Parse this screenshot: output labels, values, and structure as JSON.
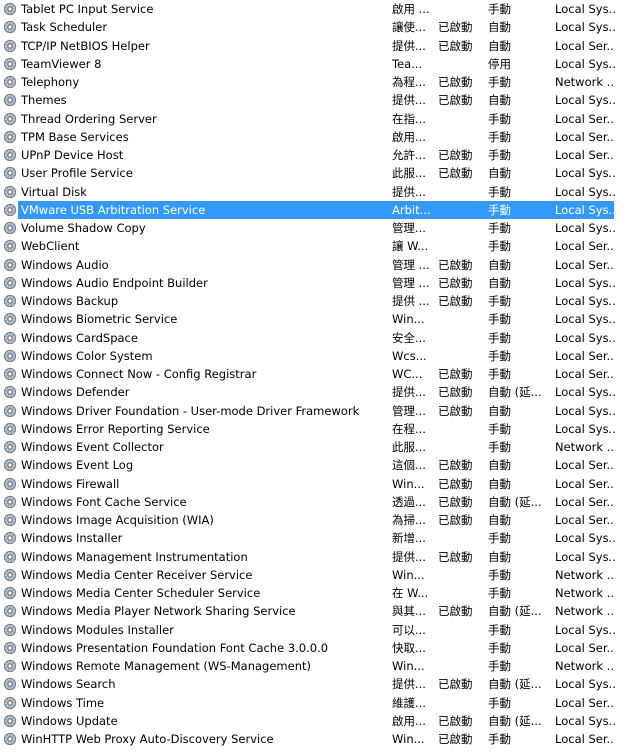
{
  "services": [
    {
      "name": "Tablet PC Input Service",
      "desc": "啟用 ...",
      "status": "",
      "startup": "手動",
      "logon": "Local Sys..."
    },
    {
      "name": "Task Scheduler",
      "desc": "讓使...",
      "status": "已啟動",
      "startup": "自動",
      "logon": "Local Sys..."
    },
    {
      "name": "TCP/IP NetBIOS Helper",
      "desc": "提供...",
      "status": "已啟動",
      "startup": "自動",
      "logon": "Local Ser..."
    },
    {
      "name": "TeamViewer 8",
      "desc": "Tea...",
      "status": "",
      "startup": "停用",
      "logon": "Local Sys..."
    },
    {
      "name": "Telephony",
      "desc": "為程...",
      "status": "已啟動",
      "startup": "手動",
      "logon": "Network ..."
    },
    {
      "name": "Themes",
      "desc": "提供...",
      "status": "已啟動",
      "startup": "自動",
      "logon": "Local Sys..."
    },
    {
      "name": "Thread Ordering Server",
      "desc": "在指...",
      "status": "",
      "startup": "手動",
      "logon": "Local Ser..."
    },
    {
      "name": "TPM Base Services",
      "desc": "啟用...",
      "status": "",
      "startup": "手動",
      "logon": "Local Ser..."
    },
    {
      "name": "UPnP Device Host",
      "desc": "允許...",
      "status": "已啟動",
      "startup": "手動",
      "logon": "Local Ser..."
    },
    {
      "name": "User Profile Service",
      "desc": "此服...",
      "status": "已啟動",
      "startup": "自動",
      "logon": "Local Sys..."
    },
    {
      "name": "Virtual Disk",
      "desc": "提供...",
      "status": "",
      "startup": "手動",
      "logon": "Local Sys..."
    },
    {
      "name": "VMware USB Arbitration Service",
      "desc": "Arbit...",
      "status": "",
      "startup": "手動",
      "logon": "Local Sys...",
      "selected": true
    },
    {
      "name": "Volume Shadow Copy",
      "desc": "管理...",
      "status": "",
      "startup": "手動",
      "logon": "Local Sys..."
    },
    {
      "name": "WebClient",
      "desc": "讓 W...",
      "status": "",
      "startup": "手動",
      "logon": "Local Ser..."
    },
    {
      "name": "Windows Audio",
      "desc": "管理 ...",
      "status": "已啟動",
      "startup": "自動",
      "logon": "Local Ser..."
    },
    {
      "name": "Windows Audio Endpoint Builder",
      "desc": "管理 ...",
      "status": "已啟動",
      "startup": "自動",
      "logon": "Local Sys..."
    },
    {
      "name": "Windows Backup",
      "desc": "提供 ...",
      "status": "已啟動",
      "startup": "手動",
      "logon": "Local Sys..."
    },
    {
      "name": "Windows Biometric Service",
      "desc": "Win...",
      "status": "",
      "startup": "手動",
      "logon": "Local Sys..."
    },
    {
      "name": "Windows CardSpace",
      "desc": "安全...",
      "status": "",
      "startup": "手動",
      "logon": "Local Sys..."
    },
    {
      "name": "Windows Color System",
      "desc": "Wcs...",
      "status": "",
      "startup": "手動",
      "logon": "Local Ser..."
    },
    {
      "name": "Windows Connect Now - Config Registrar",
      "desc": "WC...",
      "status": "已啟動",
      "startup": "手動",
      "logon": "Local Ser..."
    },
    {
      "name": "Windows Defender",
      "desc": "提供...",
      "status": "已啟動",
      "startup": "自動 (延...",
      "logon": "Local Sys..."
    },
    {
      "name": "Windows Driver Foundation - User-mode Driver Framework",
      "desc": "管理...",
      "status": "已啟動",
      "startup": "自動",
      "logon": "Local Sys..."
    },
    {
      "name": "Windows Error Reporting Service",
      "desc": "在程...",
      "status": "",
      "startup": "手動",
      "logon": "Local Sys..."
    },
    {
      "name": "Windows Event Collector",
      "desc": "此服...",
      "status": "",
      "startup": "手動",
      "logon": "Network ..."
    },
    {
      "name": "Windows Event Log",
      "desc": "這個...",
      "status": "已啟動",
      "startup": "自動",
      "logon": "Local Ser..."
    },
    {
      "name": "Windows Firewall",
      "desc": "Win...",
      "status": "已啟動",
      "startup": "自動",
      "logon": "Local Ser..."
    },
    {
      "name": "Windows Font Cache Service",
      "desc": "透過...",
      "status": "已啟動",
      "startup": "自動 (延...",
      "logon": "Local Ser..."
    },
    {
      "name": "Windows Image Acquisition (WIA)",
      "desc": "為掃...",
      "status": "已啟動",
      "startup": "自動",
      "logon": "Local Ser..."
    },
    {
      "name": "Windows Installer",
      "desc": "新增...",
      "status": "",
      "startup": "手動",
      "logon": "Local Sys..."
    },
    {
      "name": "Windows Management Instrumentation",
      "desc": "提供...",
      "status": "已啟動",
      "startup": "自動",
      "logon": "Local Sys..."
    },
    {
      "name": "Windows Media Center Receiver Service",
      "desc": "Win...",
      "status": "",
      "startup": "手動",
      "logon": "Network ..."
    },
    {
      "name": "Windows Media Center Scheduler Service",
      "desc": "在 W...",
      "status": "",
      "startup": "手動",
      "logon": "Network ..."
    },
    {
      "name": "Windows Media Player Network Sharing Service",
      "desc": "與其...",
      "status": "已啟動",
      "startup": "自動 (延...",
      "logon": "Network ..."
    },
    {
      "name": "Windows Modules Installer",
      "desc": "可以...",
      "status": "",
      "startup": "手動",
      "logon": "Local Sys..."
    },
    {
      "name": "Windows Presentation Foundation Font Cache 3.0.0.0",
      "desc": "快取...",
      "status": "",
      "startup": "手動",
      "logon": "Local Ser..."
    },
    {
      "name": "Windows Remote Management (WS-Management)",
      "desc": "Win...",
      "status": "",
      "startup": "手動",
      "logon": "Network ..."
    },
    {
      "name": "Windows Search",
      "desc": "提供...",
      "status": "已啟動",
      "startup": "自動 (延...",
      "logon": "Local Sys..."
    },
    {
      "name": "Windows Time",
      "desc": "維護...",
      "status": "",
      "startup": "手動",
      "logon": "Local Ser..."
    },
    {
      "name": "Windows Update",
      "desc": "啟用...",
      "status": "已啟動",
      "startup": "自動 (延...",
      "logon": "Local Sys..."
    },
    {
      "name": "WinHTTP Web Proxy Auto-Discovery Service",
      "desc": "Win...",
      "status": "已啟動",
      "startup": "手動",
      "logon": "Local Ser..."
    }
  ]
}
